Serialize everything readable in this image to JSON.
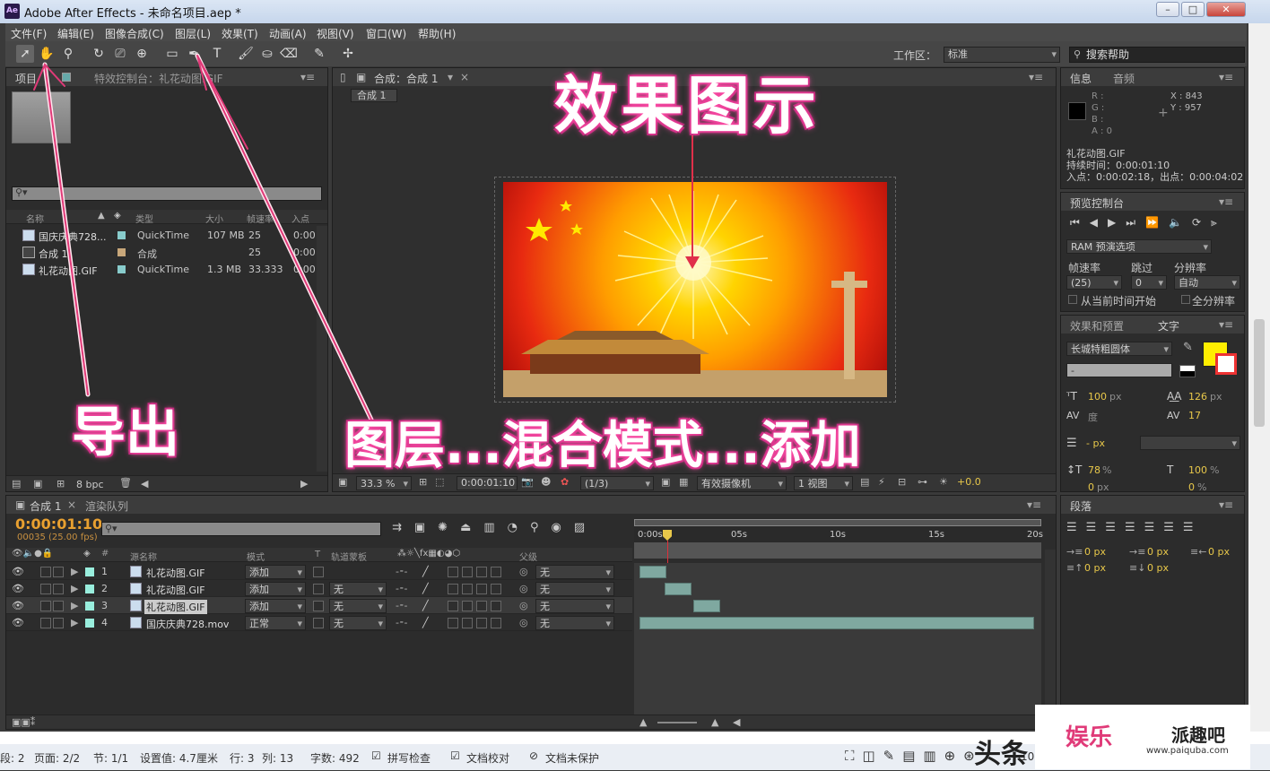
{
  "window": {
    "title": "Adobe After Effects - 未命名项目.aep *",
    "app_icon": "Ae"
  },
  "menu": [
    "文件(F)",
    "编辑(E)",
    "图像合成(C)",
    "图层(L)",
    "效果(T)",
    "动画(A)",
    "视图(V)",
    "窗口(W)",
    "帮助(H)"
  ],
  "toolbar": {
    "workspace_label": "工作区：",
    "workspace_value": "标准",
    "search_placeholder": "搜索帮助"
  },
  "project": {
    "tab_project": "项目",
    "tab_effects": "特效控制台：礼花动图.GIF",
    "columns": [
      "名称",
      "类型",
      "大小",
      "帧速率",
      "入点"
    ],
    "items": [
      {
        "name": "国庆庆典728...",
        "type": "QuickTime",
        "size": "107 MB",
        "fps": "25",
        "in": "0:00"
      },
      {
        "name": "合成 1",
        "type": "合成",
        "size": "",
        "fps": "25",
        "in": "0:00"
      },
      {
        "name": "礼花动图.GIF",
        "type": "QuickTime",
        "size": "1.3 MB",
        "fps": "33.333",
        "in": "0:00"
      }
    ],
    "bpc": "8 bpc"
  },
  "comp": {
    "tab": "合成：合成 1",
    "crumb": "合成 1",
    "zoom": "33.3 %",
    "time": "0:00:01:10",
    "resolution": "(1/3)",
    "camera": "有效摄像机",
    "views": "1 视图",
    "exposure": "+0.0"
  },
  "info": {
    "tab_info": "信息",
    "tab_audio": "音频",
    "rgba": [
      "R :",
      "G :",
      "B :",
      "A : 0"
    ],
    "x": "X : 843",
    "y": "Y : 957",
    "layer": "礼花动图.GIF",
    "duration": "持续时间：0:00:01:10",
    "inout": "入点：0:00:02:18，出点：0:00:04:02"
  },
  "preview": {
    "tab": "预览控制台",
    "ram": "RAM 预演选项",
    "fps_label": "帧速率",
    "skip_label": "跳过",
    "res_label": "分辨率",
    "fps_value": "(25)",
    "skip_value": "0",
    "res_value": "自动",
    "from_current": "从当前时间开始",
    "full_screen": "全分辨率"
  },
  "char": {
    "tab_fx": "效果和预置",
    "tab_text": "文字",
    "font": "长城特粗圆体",
    "style": "-",
    "size": "100",
    "leading": "126",
    "kern": "度",
    "tracking": "17",
    "stroke": "- px",
    "vscale": "78",
    "hscale": "100",
    "baseline": "0",
    "tsume": "0",
    "fill_color": "#ffee00",
    "unit_px": "px",
    "unit_pct": "%"
  },
  "para": {
    "tab": "段落",
    "val": "0 px"
  },
  "timeline": {
    "tab_comp": "合成 1",
    "tab_render": "渲染队列",
    "time": "0:00:01:10",
    "frames": "00035 (25.00 fps)",
    "col_src": "源名称",
    "col_mode": "模式",
    "col_t": "T",
    "col_track": "轨道蒙板",
    "col_parent": "父级",
    "ruler": [
      "0:00s",
      "05s",
      "10s",
      "15s",
      "20s"
    ],
    "layers": [
      {
        "num": "1",
        "name": "礼花动图.GIF",
        "mode": "添加",
        "track": "",
        "parent": "无"
      },
      {
        "num": "2",
        "name": "礼花动图.GIF",
        "mode": "添加",
        "track": "无",
        "parent": "无"
      },
      {
        "num": "3",
        "name": "礼花动图.GIF",
        "mode": "添加",
        "track": "无",
        "parent": "无"
      },
      {
        "num": "4",
        "name": "国庆庆典728.mov",
        "mode": "正常",
        "track": "无",
        "parent": "无"
      }
    ]
  },
  "annotations": {
    "effect": "效果图示",
    "export": "导出",
    "layer_mode": "图层...混合模式...添加"
  },
  "statusbar": {
    "items": [
      "段: 2",
      "页面: 2/2",
      "节: 1/1",
      "设置值: 4.7厘米",
      "行: 3",
      "列: 13",
      "字数: 492",
      "拼写检查",
      "文档校对",
      "文档未保护"
    ],
    "zoom": "10",
    "watermark1": "头条",
    "watermark2": "娱乐",
    "watermark3": "派趣吧",
    "watermark_url": "www.paiquba.com"
  }
}
